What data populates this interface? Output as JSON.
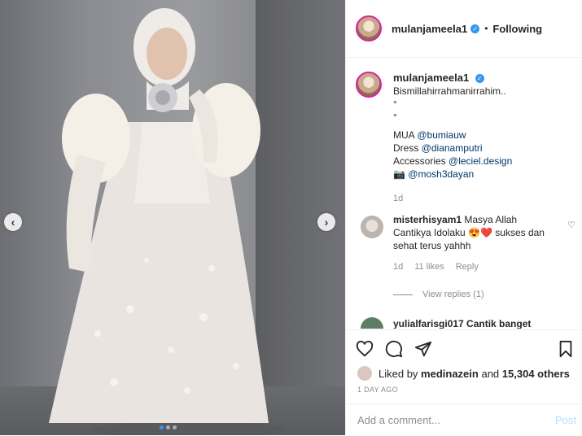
{
  "header": {
    "username": "mulanjameela1",
    "follow_label": "Following",
    "separator": "•"
  },
  "caption": {
    "username": "mulanjameela1",
    "lines": [
      "Bismillahirrahmanirrahim..",
      "°",
      "°"
    ],
    "credits": [
      {
        "label": "MUA",
        "handle": "@bumiauw"
      },
      {
        "label": "Dress",
        "handle": "@dianamputri"
      },
      {
        "label": "Accessories",
        "handle": "@leciel.design"
      },
      {
        "label": "📷",
        "handle": "@mosh3dayan"
      }
    ],
    "time": "1d"
  },
  "comment": {
    "username": "misterhisyam1",
    "text": "Masya Allah Cantikya Idolaku 😍❤️ sukses dan sehat terus yahhh",
    "time": "1d",
    "likes": "11 likes",
    "reply": "Reply",
    "view_replies": "View replies (1)"
  },
  "peek_comment": {
    "text": "yulialfarisgi017  Cantik banget"
  },
  "likes": {
    "prefix": "Liked by",
    "user": "medinazein",
    "and": "and",
    "count": "15,304 others"
  },
  "date": "1 DAY AGO",
  "add_comment": {
    "placeholder": "Add a comment...",
    "post_label": "Post"
  },
  "carousel": {
    "prev": "‹",
    "next": "›",
    "dots": 3,
    "active": 1
  },
  "colors": {
    "accent": "#3897f0",
    "post_disabled": "#b2dffc",
    "muted": "#8e8e8e"
  }
}
